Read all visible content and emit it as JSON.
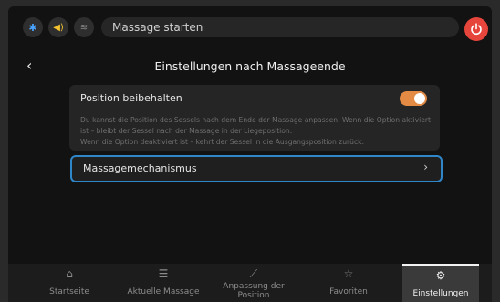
{
  "topbar": {
    "bluetooth_icon": "bluetooth-icon",
    "sound_icon": "sound-icon",
    "heat_icon": "heat-icon",
    "message": "Massage starten",
    "power_icon": "power-icon",
    "power_color": "#e5453b"
  },
  "header": {
    "title": "Einstellungen nach Massageende",
    "back_icon": "chevron-left-icon"
  },
  "position_option": {
    "label": "Position beibehalten",
    "toggle_on": true,
    "toggle_color": "#e38a45",
    "description_line1": "Du kannst die Position des Sessels nach dem Ende der Massage anpassen. Wenn die Option aktiviert ist – bleibt der Sessel nach der Massage in der Liegeposition.",
    "description_line2": "Wenn die Option deaktiviert ist – kehrt der Sessel in die Ausgangsposition zurück."
  },
  "mechanism": {
    "label": "Massagemechanismus",
    "chevron_icon": "chevron-right-icon",
    "focus_color": "#2f86c9"
  },
  "nav": {
    "items": [
      {
        "label": "Startseite",
        "icon": "home-icon"
      },
      {
        "label": "Aktuelle Massage",
        "icon": "sliders-icon"
      },
      {
        "label": "Anpassung der Position",
        "icon": "recline-icon"
      },
      {
        "label": "Favoriten",
        "icon": "star-icon"
      },
      {
        "label": "Einstellungen",
        "icon": "gear-icon",
        "active": true
      }
    ]
  }
}
